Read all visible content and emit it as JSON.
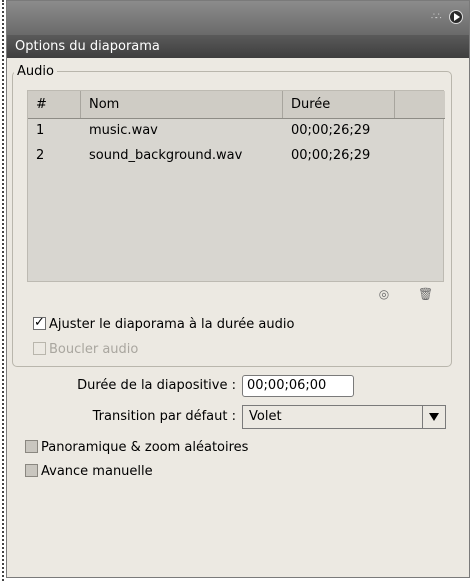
{
  "panel": {
    "title": "Options du diaporama"
  },
  "audio": {
    "legend": "Audio",
    "columns": [
      "#",
      "Nom",
      "Durée"
    ],
    "rows": [
      {
        "index": "1",
        "name": "music.wav",
        "duration": "00;00;26;29"
      },
      {
        "index": "2",
        "name": "sound_background.wav",
        "duration": "00;00;26;29"
      }
    ],
    "icons": {
      "loop": "loop-icon",
      "delete": "trash-icon"
    },
    "fit_label": "Ajuster le diaporama à la durée audio",
    "fit_checked": true,
    "loop_label": "Boucler audio",
    "loop_checked": false,
    "loop_disabled": true
  },
  "slide": {
    "duration_label": "Durée de la diapositive :",
    "duration_value": "00;00;06;00",
    "transition_label": "Transition par défaut :",
    "transition_value": "Volet"
  },
  "options": {
    "pan_zoom_label": "Panoramique & zoom aléatoires",
    "pan_zoom_checked": false,
    "manual_advance_label": "Avance manuelle",
    "manual_advance_checked": false
  },
  "colors": {
    "panel_bg": "#ece9e2",
    "title_bg": "#4a4a4a",
    "table_bg": "#d8d6d0"
  }
}
